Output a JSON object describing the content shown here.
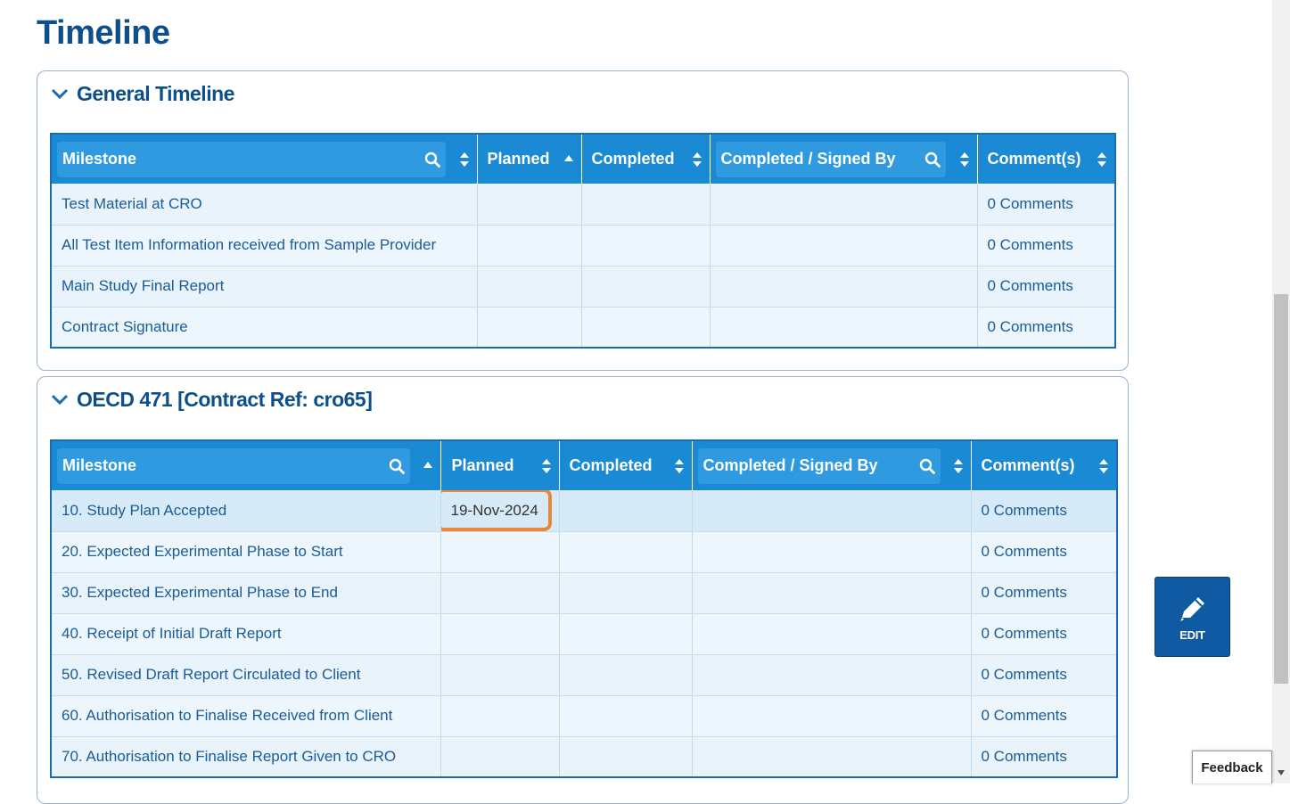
{
  "page": {
    "title": "Timeline"
  },
  "general": {
    "title": "General Timeline",
    "columns": [
      "Milestone",
      "Planned",
      "Completed",
      "Completed / Signed By",
      "Comment(s)"
    ],
    "rows": [
      {
        "milestone": "Test Material at CRO",
        "planned": "",
        "completed": "",
        "signed_by": "",
        "comments": "0 Comments"
      },
      {
        "milestone": "All Test Item Information received from Sample Provider",
        "planned": "",
        "completed": "",
        "signed_by": "",
        "comments": "0 Comments"
      },
      {
        "milestone": "Main Study Final Report",
        "planned": "",
        "completed": "",
        "signed_by": "",
        "comments": "0 Comments"
      },
      {
        "milestone": "Contract Signature",
        "planned": "",
        "completed": "",
        "signed_by": "",
        "comments": "0 Comments"
      }
    ]
  },
  "oecd": {
    "title": "OECD 471 [Contract Ref: cro65]",
    "columns": [
      "Milestone",
      "Planned",
      "Completed",
      "Completed / Signed By",
      "Comment(s)"
    ],
    "rows": [
      {
        "milestone": "10. Study Plan Accepted",
        "planned": "19-Nov-2024",
        "completed": "",
        "signed_by": "",
        "comments": "0 Comments"
      },
      {
        "milestone": "20. Expected Experimental Phase to Start",
        "planned": "",
        "completed": "",
        "signed_by": "",
        "comments": "0 Comments"
      },
      {
        "milestone": "30. Expected Experimental Phase to End",
        "planned": "",
        "completed": "",
        "signed_by": "",
        "comments": "0 Comments"
      },
      {
        "milestone": "40. Receipt of Initial Draft Report",
        "planned": "",
        "completed": "",
        "signed_by": "",
        "comments": "0 Comments"
      },
      {
        "milestone": "50. Revised Draft Report Circulated to Client",
        "planned": "",
        "completed": "",
        "signed_by": "",
        "comments": "0 Comments"
      },
      {
        "milestone": "60. Authorisation to Finalise Received from Client",
        "planned": "",
        "completed": "",
        "signed_by": "",
        "comments": "0 Comments"
      },
      {
        "milestone": "70. Authorisation to Finalise Report Given to CRO",
        "planned": "",
        "completed": "",
        "signed_by": "",
        "comments": "0 Comments"
      }
    ]
  },
  "edit_button": {
    "label": "EDIT",
    "icon": "pencil-icon"
  },
  "feedback": {
    "label": "Feedback"
  },
  "colors": {
    "header_bg": "#1a8ad4",
    "title": "#0d4f8b",
    "highlight": "#e8893a",
    "edit_bg": "#0f5aa3"
  }
}
